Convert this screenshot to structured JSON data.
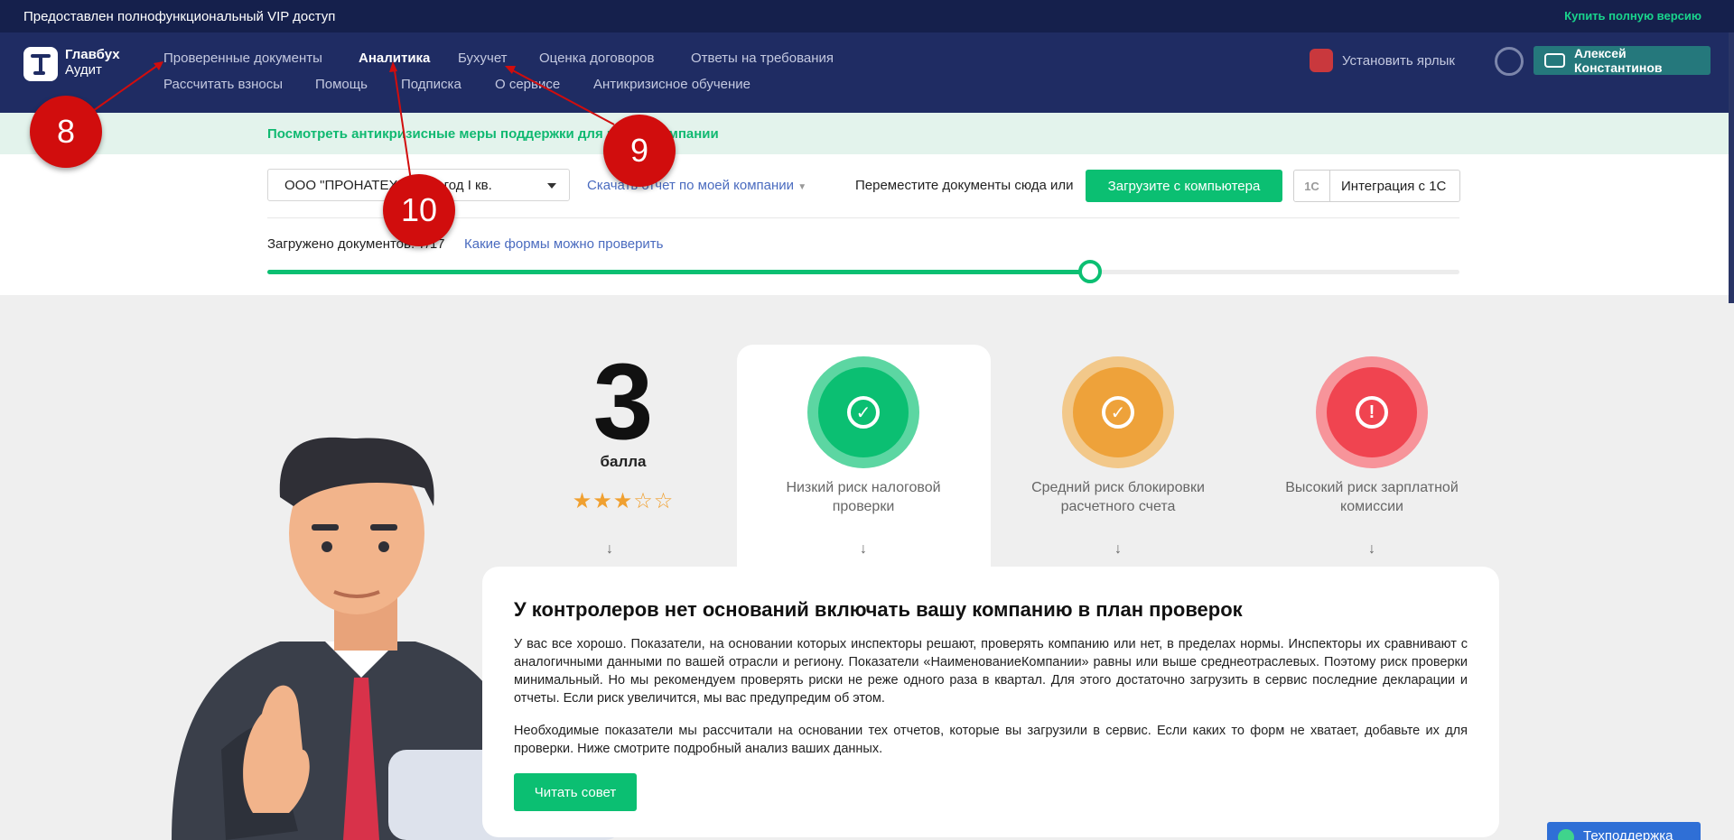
{
  "topbar": {
    "vip_text": "Предоставлен полнофункциональный VIP доступ",
    "buy_link": "Купить полную версию"
  },
  "logo": {
    "name": "Главбух",
    "sub": "Аудит"
  },
  "nav": {
    "row1": [
      "Проверенные документы",
      "Аналитика",
      "Бухучет",
      "Оценка договоров",
      "Ответы на требования"
    ],
    "row2": [
      "Рассчитать взносы",
      "Помощь",
      "Подписка",
      "О сервисе",
      "Антикризисное обучение"
    ],
    "active": "Аналитика"
  },
  "header": {
    "shortcut_label": "Установить ярлык",
    "user_name": "Алексей Константинов"
  },
  "banner": {
    "text": "Посмотреть антикризисные меры поддержки для вашей компании"
  },
  "controls": {
    "company_select": "ООО \"ПРОНАТЕХ\", 2022 год I кв.",
    "report_link": "Скачать отчет по моей компании",
    "move_text": "Переместите документы сюда или",
    "upload_button": "Загрузите с компьютера",
    "integration_icon": "1С",
    "integration_button": "Интеграция с 1С",
    "loaded_label": "Загружено документов: 7/17",
    "forms_link": "Какие формы можно проверить",
    "progress_fraction": 0.69
  },
  "score": {
    "value": "3",
    "label": "балла",
    "stars": "★★★☆☆",
    "rating": 3,
    "max": 5
  },
  "risks": [
    {
      "label": "Низкий риск налоговой проверки",
      "color": "#0bbf72",
      "ring": "#5cd6a2",
      "icon": "check-circle-icon"
    },
    {
      "label": "Средний риск блокировки расчетного счета",
      "color": "#eea23a",
      "ring": "#f2c88a",
      "icon": "check-circle-icon"
    },
    {
      "label": "Высокий риск зарплатной комиссии",
      "color": "#f04450",
      "ring": "#f7949a",
      "icon": "alert-circle-icon"
    }
  ],
  "advice": {
    "title": "У контролеров нет оснований включать вашу компанию в план проверок",
    "p1": "У вас все хорошо. Показатели, на основании которых инспекторы решают, проверять компанию или нет, в пределах нормы. Инспекторы их сравнивают с аналогичными данными по вашей отрасли и региону. Показатели «НаименованиеКомпании» равны или выше среднеотраслевых. Поэтому риск проверки минимальный. Но мы рекомендуем проверять риски не реже одного раза в квартал. Для этого достаточно загрузить в сервис последние декларации и отчеты. Если риск увеличится, мы вас предупредим об этом.",
    "p2": "Необходимые показатели мы рассчитали на основании тех отчетов, которые вы загрузили в сервис. Если каких то форм не хватает, добавьте их для проверки. Ниже смотрите подробный анализ ваших данных.",
    "button": "Читать совет"
  },
  "support": {
    "label": "Техподдержка"
  },
  "markers": [
    "8",
    "9",
    "10"
  ],
  "arrow_glyph": "↓"
}
